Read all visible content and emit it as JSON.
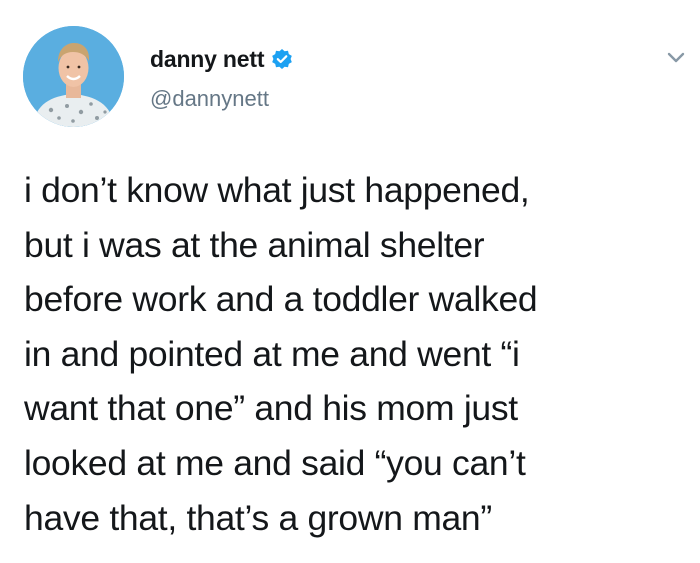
{
  "tweet": {
    "author": {
      "display_name": "danny nett",
      "handle": "@dannynett",
      "verified": true,
      "avatar_icon": "profile-photo"
    },
    "menu_icon": "chevron-down-icon",
    "text": "i don’t know what just happened,\nbut i was at the animal shelter\nbefore work and a toddler walked\nin and pointed at me and went “i\nwant that one” and his mom just\nlooked at me and said “you can’t\nhave that, that’s a grown man”"
  },
  "colors": {
    "text": "#14171a",
    "handle": "#657786",
    "verified_badge": "#1da1f2",
    "avatar_background": "#5aaee0"
  }
}
